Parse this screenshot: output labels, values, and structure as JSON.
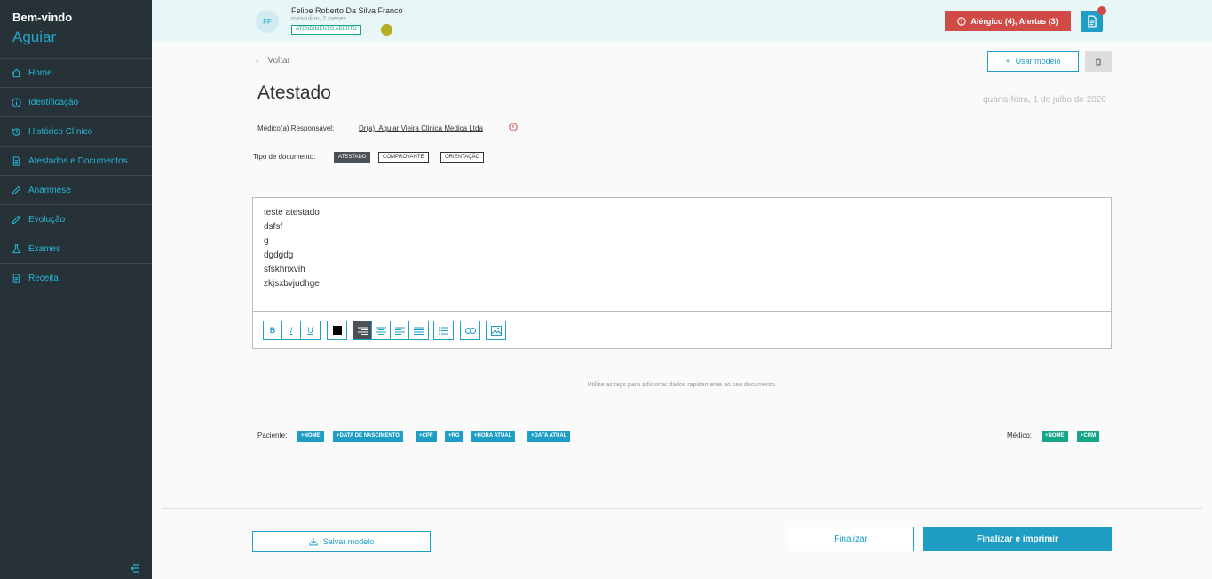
{
  "sidebar": {
    "welcome": "Bem-vindo",
    "user": "Aguiar",
    "items": [
      {
        "label": "Home",
        "icon": "home-icon"
      },
      {
        "label": "Identificação",
        "icon": "info-icon"
      },
      {
        "label": "Histórico Clínico",
        "icon": "history-icon"
      },
      {
        "label": "Atestados e Documentos",
        "icon": "document-icon"
      },
      {
        "label": "Anamnese",
        "icon": "pencil-icon"
      },
      {
        "label": "Evolução",
        "icon": "pencil-icon"
      },
      {
        "label": "Exames",
        "icon": "flask-icon"
      },
      {
        "label": "Receita",
        "icon": "document-icon"
      }
    ]
  },
  "patient": {
    "initials": "FF",
    "name": "Felipe Roberto Da Silva Franco",
    "sub": "masculino, 2 meses",
    "status": "ATENDIMENTO ABERTO",
    "alert": "Alérgico (4),  Alertas (3)"
  },
  "page": {
    "back": "Voltar",
    "use_model": "Usar modelo",
    "title": "Atestado",
    "date": "quarta-feira, 1 de julho de 2020",
    "medico_label": "Médico(a) Responsável:",
    "medico_value": "Dr(a). Aguiar Vieira Clinica Medica Ltda",
    "tipo_label": "Tipo de documento:",
    "tipos": [
      "ATESTADO",
      "COMPROVANTE",
      "ORIENTAÇÃO"
    ],
    "editor_lines": [
      "teste atestado",
      "dsfsf",
      "g",
      "dgdgdg",
      "sfskhnxvih",
      "zkjsxbvjudhge"
    ],
    "hint": "Utilize as tags para adicionar dados rapidamente ao seu documento.",
    "paciente_label": "Paciente:",
    "paciente_tags": [
      "+NOME",
      "+DATA DE NASCIMENTO",
      "+CPF",
      "+RG",
      "+HORA ATUAL",
      "+DATA ATUAL"
    ],
    "medico_tags_label": "Médico:",
    "medico_tags": [
      "+NOME",
      "+CRM"
    ],
    "save_model": "Salvar modelo",
    "finalize": "Finalizar",
    "finalize_print": "Finalizar e imprimir"
  },
  "colors": {
    "accent": "#1f9ec5",
    "sidebar": "#263238",
    "danger": "#d04a46",
    "green": "#15a589"
  }
}
